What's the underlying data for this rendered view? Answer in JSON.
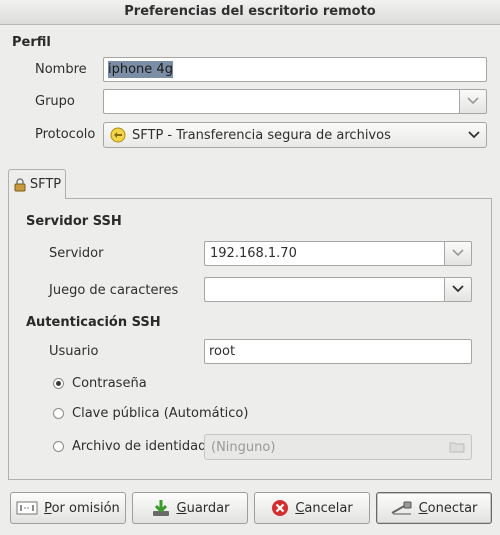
{
  "window": {
    "title": "Preferencias del escritorio remoto"
  },
  "profile": {
    "section_title": "Perfil",
    "name_label": "Nombre",
    "name_value": "iphone 4g",
    "group_label": "Grupo",
    "group_value": "",
    "protocol_label": "Protocolo",
    "protocol_value": "SFTP - Transferencia segura de archivos"
  },
  "tabs": [
    {
      "label": "SFTP"
    }
  ],
  "ssh": {
    "server_section_title": "Servidor SSH",
    "server_label": "Servidor",
    "server_value": "192.168.1.70",
    "charset_label": "Juego de caracteres",
    "charset_value": "",
    "auth_section_title": "Autenticación SSH",
    "user_label": "Usuario",
    "user_value": "root",
    "auth_options": [
      {
        "label": "Contraseña",
        "selected": true
      },
      {
        "label": "Clave pública (Automático)",
        "selected": false
      },
      {
        "label": "Archivo de identidad",
        "selected": false
      }
    ],
    "identity_file_value": "(Ninguno)"
  },
  "buttons": {
    "default_pre": "",
    "default_key": "P",
    "default_post": "or omisión",
    "save_pre": "",
    "save_key": "G",
    "save_post": "uardar",
    "cancel_pre": "",
    "cancel_key": "C",
    "cancel_post": "ancelar",
    "connect_pre": "",
    "connect_key": "C",
    "connect_post": "onectar"
  },
  "icons": {
    "protocol_icon": "sftp-icon",
    "tab_icon": "lock-folder-icon",
    "default_icon": "reset-icon",
    "save_icon": "save-download-icon",
    "cancel_icon": "cancel-icon",
    "connect_icon": "connect-plug-icon"
  },
  "colors": {
    "selection": "#7c8ea6",
    "cancel_red": "#d42f2f",
    "window_bg": "#ededec"
  }
}
